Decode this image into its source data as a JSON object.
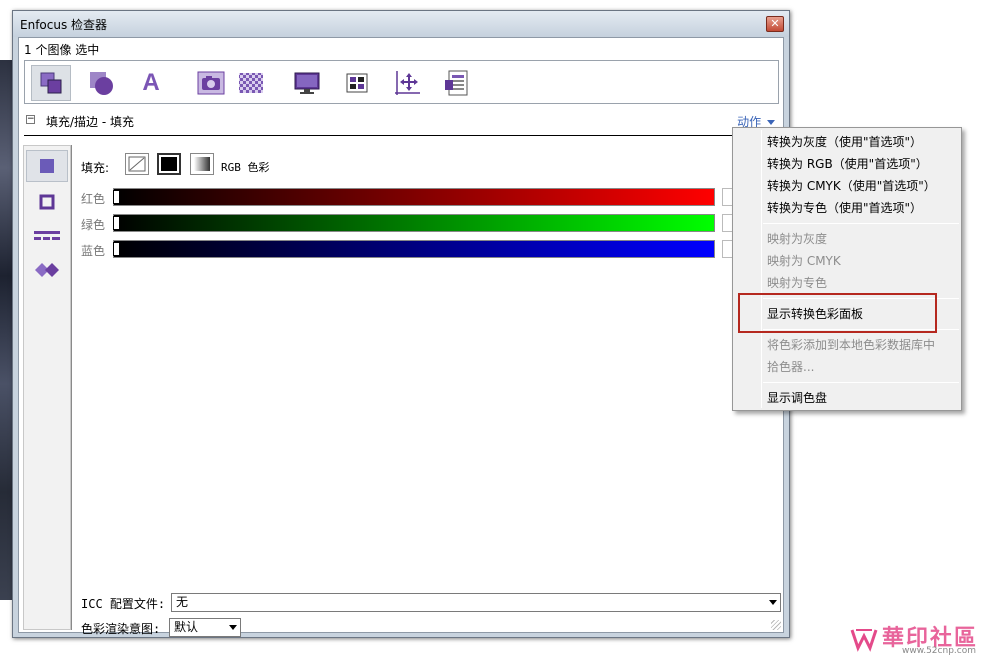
{
  "window": {
    "title": "Enfocus 检查器",
    "close_glyph": "✕"
  },
  "selection": {
    "label": "1 个图像 选中"
  },
  "toolbar": {
    "tools": [
      {
        "name": "object-tool-icon"
      },
      {
        "name": "shape-tool-icon"
      },
      {
        "name": "text-tool-icon",
        "glyph": "A"
      },
      {
        "name": "image-tool-icon"
      },
      {
        "name": "transparency-tool-icon"
      },
      {
        "name": "monitor-tool-icon"
      },
      {
        "name": "layout-tool-icon"
      },
      {
        "name": "position-tool-icon"
      },
      {
        "name": "document-tool-icon"
      }
    ]
  },
  "section": {
    "collapse_glyph": "−",
    "title": "填充/描边 - 填充",
    "action": "动作"
  },
  "fill": {
    "label": "填充:",
    "color_mode": "RGB 色彩"
  },
  "sliders": [
    {
      "name": "红色",
      "color": "#ff0000"
    },
    {
      "name": "绿色",
      "color": "#00ff00"
    },
    {
      "name": "蓝色",
      "color": "#0000ff"
    }
  ],
  "icc": {
    "label": "ICC 配置文件:",
    "value": "无"
  },
  "rendering": {
    "label": "色彩渲染意图:",
    "value": "默认"
  },
  "menu": {
    "group1": [
      "转换为灰度（使用\"首选项\"）",
      "转换为 RGB（使用\"首选项\"）",
      "转换为 CMYK（使用\"首选项\"）",
      "转换为专色（使用\"首选项\"）"
    ],
    "group2": [
      "映射为灰度",
      "映射为 CMYK",
      "映射为专色"
    ],
    "group3": [
      "显示转换色彩面板"
    ],
    "group4": [
      "将色彩添加到本地色彩数据库中",
      "拾色器..."
    ],
    "group5": [
      "显示调色盘"
    ]
  },
  "watermark": {
    "text": "華印社區",
    "url": "www.52cnp.com"
  },
  "colors": {
    "accent": "#3b65b8",
    "highlight_border": "#b5281f",
    "purple": "#6b3fa0"
  }
}
